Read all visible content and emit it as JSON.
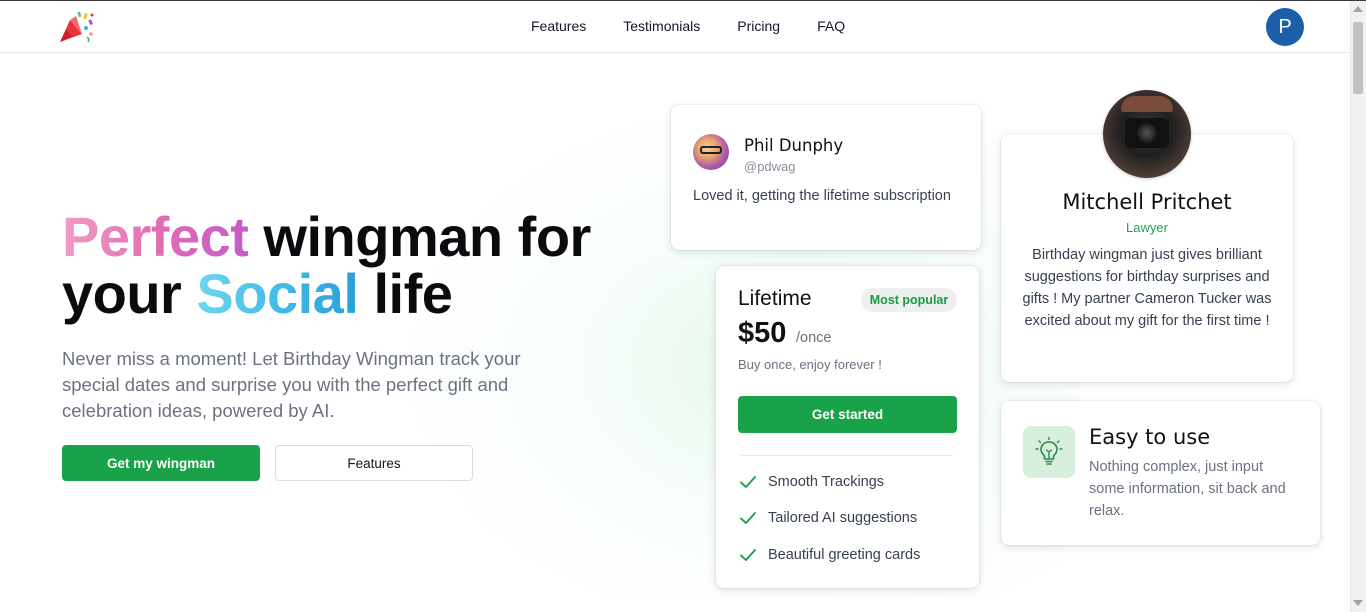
{
  "nav": {
    "links": [
      "Features",
      "Testimonials",
      "Pricing",
      "FAQ"
    ],
    "avatar_initial": "P",
    "logo_icon": "party-popper-icon"
  },
  "hero": {
    "title_word1": "Perfect",
    "title_word2": " wingman for",
    "title_word3": "your ",
    "title_word4": "Social",
    "title_word5": " life",
    "subtitle": "Never miss a moment! Let Birthday Wingman track your special dates and surprise you with the perfect gift and celebration ideas, powered by AI.",
    "primary_button": "Get my wingman",
    "secondary_button": "Features"
  },
  "testimonial_small": {
    "name": "Phil Dunphy",
    "handle": "@pdwag",
    "quote": "Loved it, getting the lifetime subscription"
  },
  "pricing": {
    "plan": "Lifetime",
    "badge": "Most popular",
    "price": "$50",
    "period": "/once",
    "note": "Buy once, enjoy forever !",
    "cta": "Get started",
    "features": [
      "Smooth Trackings",
      "Tailored AI suggestions",
      "Beautiful greeting cards"
    ]
  },
  "testimonial_profile": {
    "name": "Mitchell Pritchet",
    "role": "Lawyer",
    "quote": "Birthday wingman just gives brilliant suggestions for birthday surprises and gifts ! My partner Cameron Tucker was excited about my gift for the first time !"
  },
  "feature_card": {
    "title": "Easy to use",
    "description": "Nothing complex, just input some information, sit back and relax.",
    "icon": "lightbulb-icon"
  },
  "colors": {
    "brand_green": "#1aa24a",
    "avatar_blue": "#1d5ea8",
    "role_green": "#22a24f",
    "gradient_pink": "#e06bb5",
    "gradient_blue": "#3cb7e4"
  }
}
